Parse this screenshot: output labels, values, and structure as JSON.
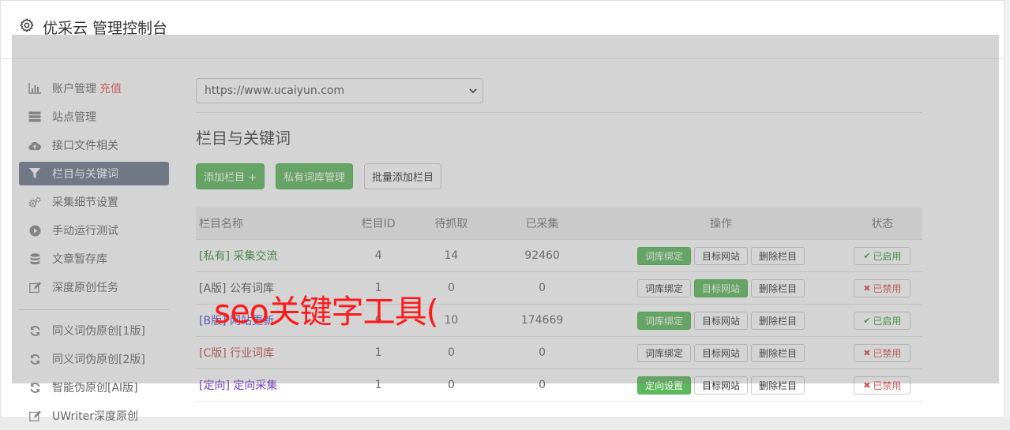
{
  "header": {
    "title": "优采云 管理控制台"
  },
  "sidebar": {
    "items": [
      {
        "label": "账户管理",
        "icon": "bar-chart-icon",
        "extra": "充值"
      },
      {
        "label": "站点管理",
        "icon": "server-icon"
      },
      {
        "label": "接口文件相关",
        "icon": "cloud-upload-icon"
      },
      {
        "label": "栏目与关键词",
        "icon": "filter-icon",
        "active": true
      },
      {
        "label": "采集细节设置",
        "icon": "cogs-icon"
      },
      {
        "label": "手动运行测试",
        "icon": "play-circle-icon"
      },
      {
        "label": "文章暂存库",
        "icon": "database-icon"
      },
      {
        "label": "深度原创任务",
        "icon": "edit-icon"
      }
    ],
    "items2": [
      {
        "label": "同义词伪原创[1版]",
        "icon": "refresh-icon"
      },
      {
        "label": "同义词伪原创[2版]",
        "icon": "refresh-icon"
      },
      {
        "label": "智能伪原创[AI版]",
        "icon": "refresh-icon"
      },
      {
        "label": "UWriter深度原创",
        "icon": "edit-icon"
      }
    ]
  },
  "main": {
    "site_select": "https://www.ucaiyun.com",
    "section_title": "栏目与关键词",
    "buttons": {
      "add": "添加栏目 +",
      "private_lib": "私有词库管理",
      "batch_add": "批量添加栏目"
    },
    "table": {
      "headers": {
        "name": "栏目名称",
        "id": "栏目ID",
        "pending": "待抓取",
        "collected": "已采集",
        "ops": "操作",
        "state": "状态"
      },
      "rows": [
        {
          "name": "[私有] 采集交流",
          "name_color": "#3c8d3c",
          "id": "4",
          "pending": "14",
          "collected": "92460",
          "op1": "词库绑定",
          "op1_green": true,
          "op2": "目标网站",
          "op2_green": false,
          "op3": "删除栏目",
          "state": "已启用",
          "state_on": true
        },
        {
          "name": "[A版] 公有词库",
          "name_color": "#555555",
          "id": "1",
          "pending": "0",
          "collected": "0",
          "op1": "词库绑定",
          "op1_green": false,
          "op2": "目标网站",
          "op2_green": true,
          "op3": "删除栏目",
          "state": "已禁用",
          "state_on": false
        },
        {
          "name": "[B版] 网站更新",
          "name_color": "#4a4acb",
          "id": "6",
          "pending": "10",
          "collected": "174669",
          "op1": "词库绑定",
          "op1_green": true,
          "op2": "目标网站",
          "op2_green": false,
          "op3": "删除栏目",
          "state": "已启用",
          "state_on": true
        },
        {
          "name": "[C版] 行业词库",
          "name_color": "#c0504d",
          "id": "1",
          "pending": "0",
          "collected": "0",
          "op1": "词库绑定",
          "op1_green": false,
          "op2": "目标网站",
          "op2_green": false,
          "op3": "删除栏目",
          "state": "已禁用",
          "state_on": false
        },
        {
          "name": "[定向] 定向采集",
          "name_color": "#7a3fc4",
          "id": "1",
          "pending": "0",
          "collected": "0",
          "op1": "定向设置",
          "op1_green": true,
          "op2": "目标网站",
          "op2_green": false,
          "op3": "删除栏目",
          "state": "已禁用",
          "state_on": false
        }
      ]
    }
  },
  "watermark": "seo关键字工具("
}
